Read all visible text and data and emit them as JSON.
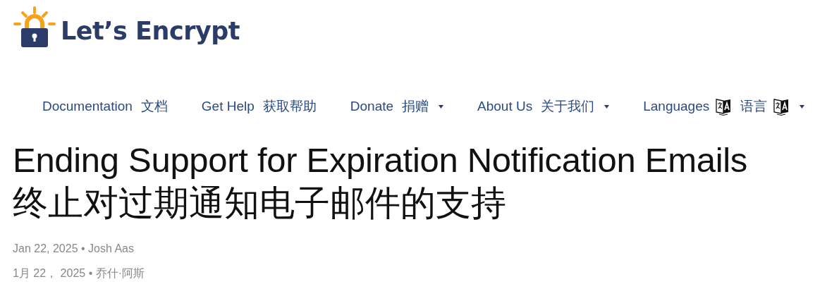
{
  "logo": {
    "text": "Let’s Encrypt"
  },
  "nav": [
    {
      "kind": "text",
      "label": "Documentation",
      "label_zh": "文档",
      "dropdown": false
    },
    {
      "kind": "text",
      "label": "Get Help",
      "label_zh": "获取帮助",
      "dropdown": false
    },
    {
      "kind": "text",
      "label": "Donate",
      "label_zh": "捐赠",
      "dropdown": true
    },
    {
      "kind": "text",
      "label": "About Us",
      "label_zh": "关于我们",
      "dropdown": true
    },
    {
      "kind": "language",
      "label": "Languages",
      "label_zh": "语言",
      "dropdown": true
    }
  ],
  "article": {
    "title": "Ending Support for Expiration Notification Emails",
    "title_zh": "终止对过期通知电子邮件的支持",
    "meta": "Jan 22, 2025 • Josh Aas",
    "meta_zh": "1月 22， 2025 • 乔什·阿斯"
  }
}
